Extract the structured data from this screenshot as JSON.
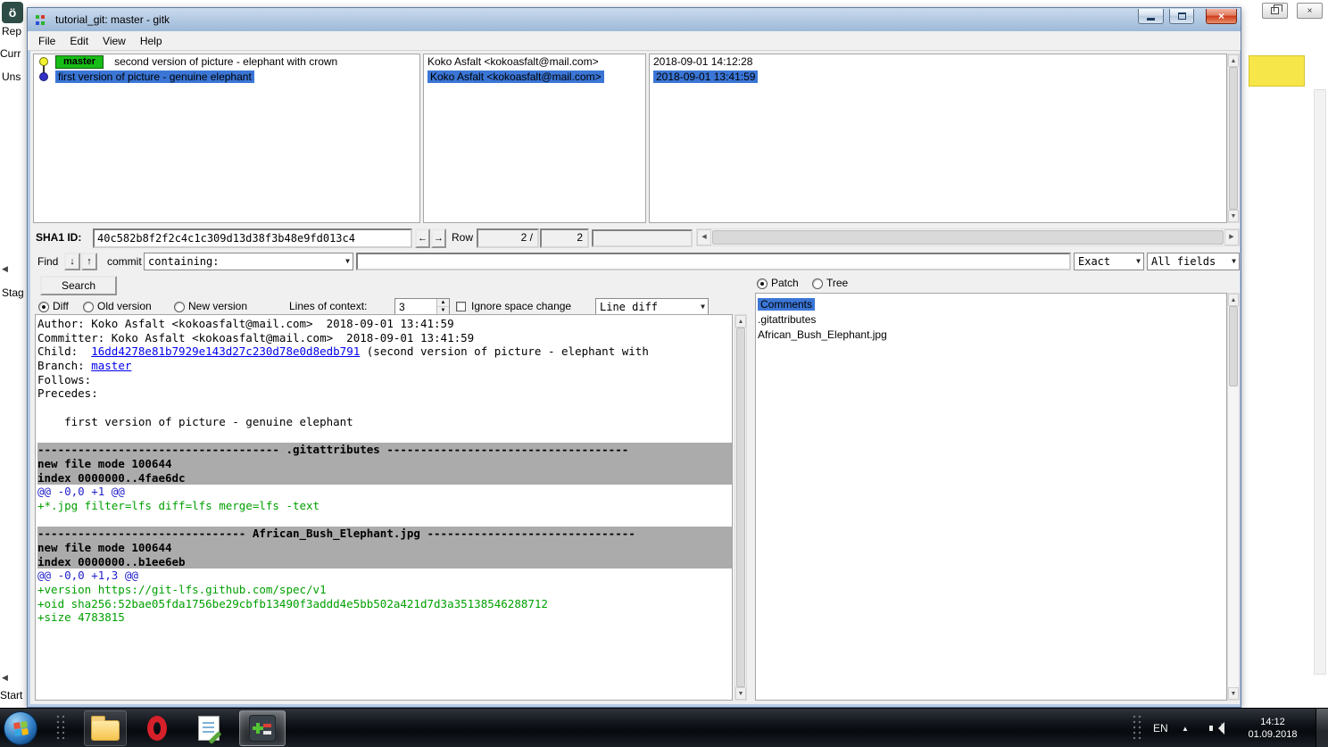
{
  "colors": {
    "selection": "#3b76d6",
    "ref-label": "#17bd17",
    "diff-head-bg": "#ababab",
    "hunk": "#2222cc",
    "add": "#00a000",
    "link": "#0000ee",
    "titlebar-top": "#cadaed",
    "titlebar-bottom": "#9db9d8"
  },
  "icons": {
    "combo_arrow": "▼",
    "spin_up": "▲",
    "spin_down": "▼",
    "scroll_up": "▲",
    "scroll_down": "▼",
    "scroll_left": "◀",
    "scroll_right": "▶",
    "find_down": "↓",
    "find_up": "↑",
    "back": "←",
    "forward": "→"
  },
  "background_app": {
    "app_glyph": "ö",
    "fragments": [
      "Rep",
      "Curr",
      "Uns",
      "Stag",
      "Start"
    ],
    "arrow": "◀",
    "caption_close": "×"
  },
  "window": {
    "title": "tutorial_git: master - gitk",
    "caption": {
      "close": "×"
    },
    "menu": [
      "File",
      "Edit",
      "View",
      "Help"
    ],
    "commit_list": {
      "rows": [
        {
          "ref": "master",
          "subject": "second version of picture - elephant with crown",
          "author": "Koko Asfalt <kokoasfalt@mail.com>",
          "date": "2018-09-01 14:12:28",
          "dot": "yellow",
          "selected": false
        },
        {
          "ref": "",
          "subject": "first version of picture - genuine elephant",
          "author": "Koko Asfalt <kokoasfalt@mail.com>",
          "date": "2018-09-01 13:41:59",
          "dot": "blue",
          "selected": true
        }
      ]
    },
    "sha1_bar": {
      "label": "SHA1 ID:",
      "value": "40c582b8f2f2c4c1c309d13d38f3b48e9fd013c4",
      "row_label": "Row",
      "row_current": "2 /",
      "row_total": "2"
    },
    "find_bar": {
      "find_label": "Find",
      "commit_label": "commit",
      "match_mode": "containing:",
      "query": "",
      "case_mode": "Exact",
      "field_mode": "All fields"
    },
    "diff_controls": {
      "search": "Search",
      "diff": "Diff",
      "old_version": "Old version",
      "new_version": "New version",
      "context_label": "Lines of context:",
      "context_value": "3",
      "ignore_space": "Ignore space change",
      "diff_mode": "Line diff"
    },
    "right_pane": {
      "patch": "Patch",
      "tree": "Tree",
      "files": [
        {
          "label": "Comments",
          "selected": true
        },
        {
          "label": ".gitattributes",
          "selected": false
        },
        {
          "label": "African_Bush_Elephant.jpg",
          "selected": false
        }
      ]
    },
    "diff": {
      "lines": [
        {
          "head": false,
          "spans": [
            {
              "t": "Author: Koko Asfalt <kokoasfalt@mail.com>  2018-09-01 13:41:59",
              "s": "plain"
            }
          ]
        },
        {
          "head": false,
          "spans": [
            {
              "t": "Committer: Koko Asfalt <kokoasfalt@mail.com>  2018-09-01 13:41:59",
              "s": "plain"
            }
          ]
        },
        {
          "head": false,
          "spans": [
            {
              "t": "Child:  ",
              "s": "plain"
            },
            {
              "t": "16dd4278e81b7929e143d27c230d78e0d8edb791",
              "s": "link"
            },
            {
              "t": " (second version of picture - elephant with",
              "s": "plain"
            }
          ]
        },
        {
          "head": false,
          "spans": [
            {
              "t": "Branch: ",
              "s": "plain"
            },
            {
              "t": "master",
              "s": "link"
            }
          ]
        },
        {
          "head": false,
          "spans": [
            {
              "t": "Follows: ",
              "s": "plain"
            }
          ]
        },
        {
          "head": false,
          "spans": [
            {
              "t": "Precedes: ",
              "s": "plain"
            }
          ]
        },
        {
          "head": false,
          "spans": []
        },
        {
          "head": false,
          "spans": [
            {
              "t": "    first version of picture - genuine elephant",
              "s": "plain"
            }
          ]
        },
        {
          "head": false,
          "spans": []
        },
        {
          "head": true,
          "spans": [
            {
              "t": "------------------------------------ .gitattributes ------------------------------------",
              "s": "plain"
            }
          ]
        },
        {
          "head": true,
          "spans": [
            {
              "t": "new file mode 100644",
              "s": "plain"
            }
          ]
        },
        {
          "head": true,
          "spans": [
            {
              "t": "index 0000000..4fae6dc",
              "s": "plain"
            }
          ]
        },
        {
          "head": false,
          "spans": [
            {
              "t": "@@ -0,0 +1 @@",
              "s": "hunk"
            }
          ]
        },
        {
          "head": false,
          "spans": [
            {
              "t": "+*.jpg filter=lfs diff=lfs merge=lfs -text",
              "s": "add"
            }
          ]
        },
        {
          "head": false,
          "spans": []
        },
        {
          "head": true,
          "spans": [
            {
              "t": "------------------------------- African_Bush_Elephant.jpg -------------------------------",
              "s": "plain"
            }
          ]
        },
        {
          "head": true,
          "spans": [
            {
              "t": "new file mode 100644",
              "s": "plain"
            }
          ]
        },
        {
          "head": true,
          "spans": [
            {
              "t": "index 0000000..b1ee6eb",
              "s": "plain"
            }
          ]
        },
        {
          "head": false,
          "spans": [
            {
              "t": "@@ -0,0 +1,3 @@",
              "s": "hunk"
            }
          ]
        },
        {
          "head": false,
          "spans": [
            {
              "t": "+version https://git-lfs.github.com/spec/v1",
              "s": "add"
            }
          ]
        },
        {
          "head": false,
          "spans": [
            {
              "t": "+oid sha256:52bae05fda1756be29cbfb13490f3addd4e5bb502a421d7d3a35138546288712",
              "s": "add"
            }
          ]
        },
        {
          "head": false,
          "spans": [
            {
              "t": "+size 4783815",
              "s": "add"
            }
          ]
        }
      ]
    }
  },
  "taskbar": {
    "language": "EN",
    "tray_expand": "▲",
    "time": "14:12",
    "date": "01.09.2018"
  }
}
